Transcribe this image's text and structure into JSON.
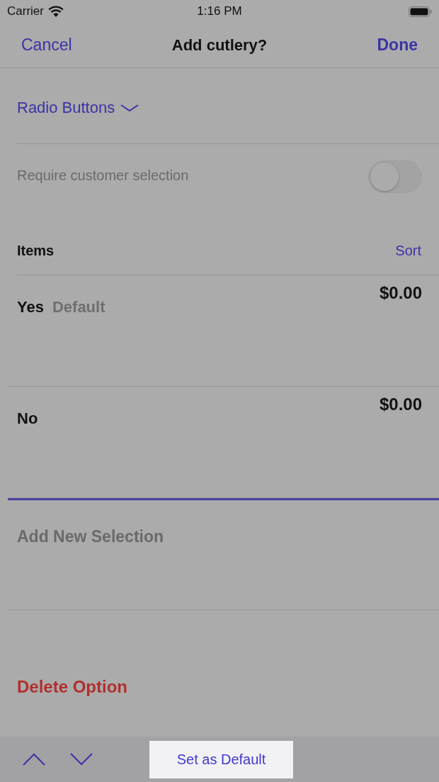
{
  "status_bar": {
    "carrier": "Carrier",
    "time": "1:16 PM"
  },
  "nav_bar": {
    "cancel": "Cancel",
    "title": "Add cutlery?",
    "done": "Done"
  },
  "type_selector": {
    "value": "Radio Buttons"
  },
  "require_selection": {
    "label": "Require customer selection",
    "on": false
  },
  "items": {
    "title": "Items",
    "sort": "Sort",
    "rows": [
      {
        "name": "Yes",
        "badge": "Default",
        "price": "$0.00"
      },
      {
        "name": "No",
        "price": "$0.00"
      }
    ]
  },
  "new_selection": {
    "placeholder": "Add New Selection",
    "focused": true
  },
  "delete_button": "Delete Option",
  "toolbar": {
    "button": "Set as Default"
  }
}
